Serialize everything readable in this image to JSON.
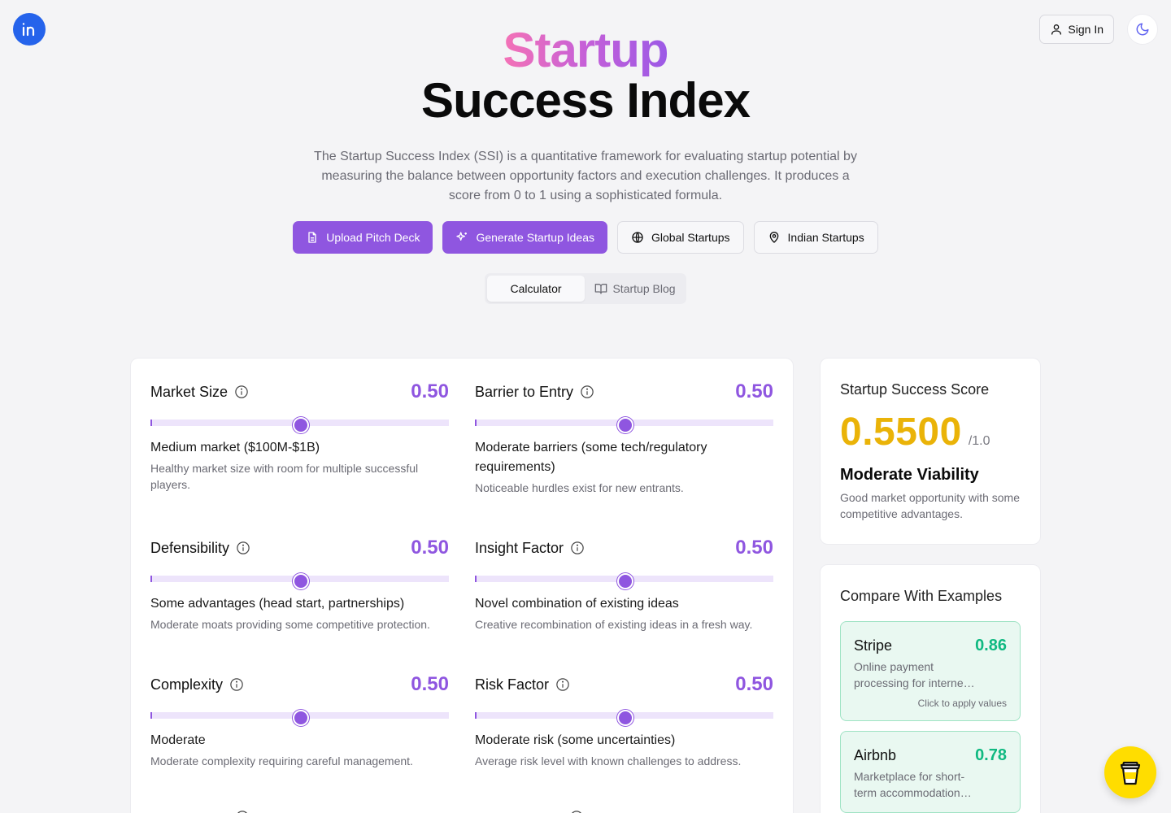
{
  "header": {
    "logo_icon": "linkedin-icon",
    "sign_in_label": "Sign In",
    "theme_icon": "moon-icon"
  },
  "hero": {
    "title_line1": "Startup",
    "title_line2": "Success Index",
    "description": "The Startup Success Index (SSI) is a quantitative framework for evaluating startup potential by measuring the balance between opportunity factors and execution challenges. It produces a score from 0 to 1 using a sophisticated formula."
  },
  "actions": {
    "upload": "Upload Pitch Deck",
    "generate": "Generate Startup Ideas",
    "global": "Global Startups",
    "indian": "Indian Startups"
  },
  "tabs": {
    "calculator": "Calculator",
    "blog": "Startup Blog"
  },
  "factors": [
    {
      "name": "Market Size",
      "value": "0.50",
      "level": 0.5,
      "label": "Medium market ($100M-$1B)",
      "description": "Healthy market size with room for multiple successful players."
    },
    {
      "name": "Barrier to Entry",
      "value": "0.50",
      "level": 0.5,
      "label": "Moderate barriers (some tech/regulatory requirements)",
      "description": "Noticeable hurdles exist for new entrants."
    },
    {
      "name": "Defensibility",
      "value": "0.50",
      "level": 0.5,
      "label": "Some advantages (head start, partnerships)",
      "description": "Moderate moats providing some competitive protection."
    },
    {
      "name": "Insight Factor",
      "value": "0.50",
      "level": 0.5,
      "label": "Novel combination of existing ideas",
      "description": "Creative recombination of existing ideas in a fresh way."
    },
    {
      "name": "Complexity",
      "value": "0.50",
      "level": 0.5,
      "label": "Moderate",
      "description": "Moderate complexity requiring careful management."
    },
    {
      "name": "Risk Factor",
      "value": "0.50",
      "level": 0.5,
      "label": "Moderate risk (some uncertainties)",
      "description": "Average risk level with known challenges to address."
    }
  ],
  "score": {
    "title": "Startup Success Score",
    "value": "0.5500",
    "max": "/1.0",
    "verdict": "Moderate Viability",
    "description": "Good market opportunity with some competitive advantages.",
    "color": "#eab308"
  },
  "compare": {
    "title": "Compare With Examples",
    "examples": [
      {
        "name": "Stripe",
        "score": "0.86",
        "description": "Online payment processing for interne…",
        "hint": "Click to apply values"
      },
      {
        "name": "Airbnb",
        "score": "0.78",
        "description": "Marketplace for short-term accommodation…"
      }
    ]
  },
  "colors": {
    "accent": "#8f56e0",
    "score_yellow": "#eab308",
    "example_green": "#10b981"
  }
}
